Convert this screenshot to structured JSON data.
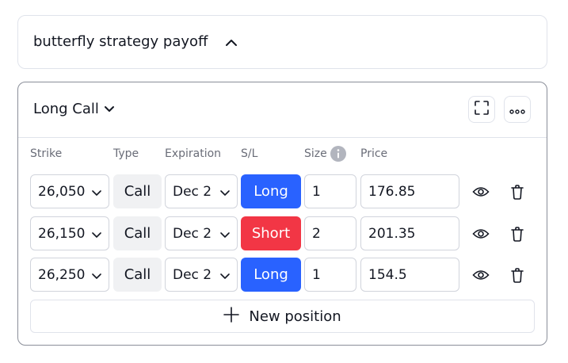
{
  "header": {
    "title": "butterfly strategy payoff"
  },
  "panel": {
    "strategy_label": "Long Call",
    "columns": {
      "strike": "Strike",
      "type": "Type",
      "expiration": "Expiration",
      "sl": "S/L",
      "size": "Size",
      "price": "Price"
    },
    "rows": [
      {
        "strike": "26,050",
        "type": "Call",
        "expiration": "Dec 2",
        "sl": "Long",
        "size": "1",
        "price": "176.85"
      },
      {
        "strike": "26,150",
        "type": "Call",
        "expiration": "Dec 2",
        "sl": "Short",
        "size": "2",
        "price": "201.35"
      },
      {
        "strike": "26,250",
        "type": "Call",
        "expiration": "Dec 2",
        "sl": "Long",
        "size": "1",
        "price": "154.5"
      }
    ],
    "new_position_label": "New position"
  },
  "colors": {
    "long": "#2962ff",
    "short": "#f23645",
    "text": "#131722",
    "muted": "#6a6d78",
    "border": "#e0e3eb"
  },
  "icons": [
    "chevron-down-icon",
    "fullscreen-icon",
    "more-icon",
    "info-icon",
    "eye-icon",
    "trash-icon",
    "plus-icon"
  ]
}
